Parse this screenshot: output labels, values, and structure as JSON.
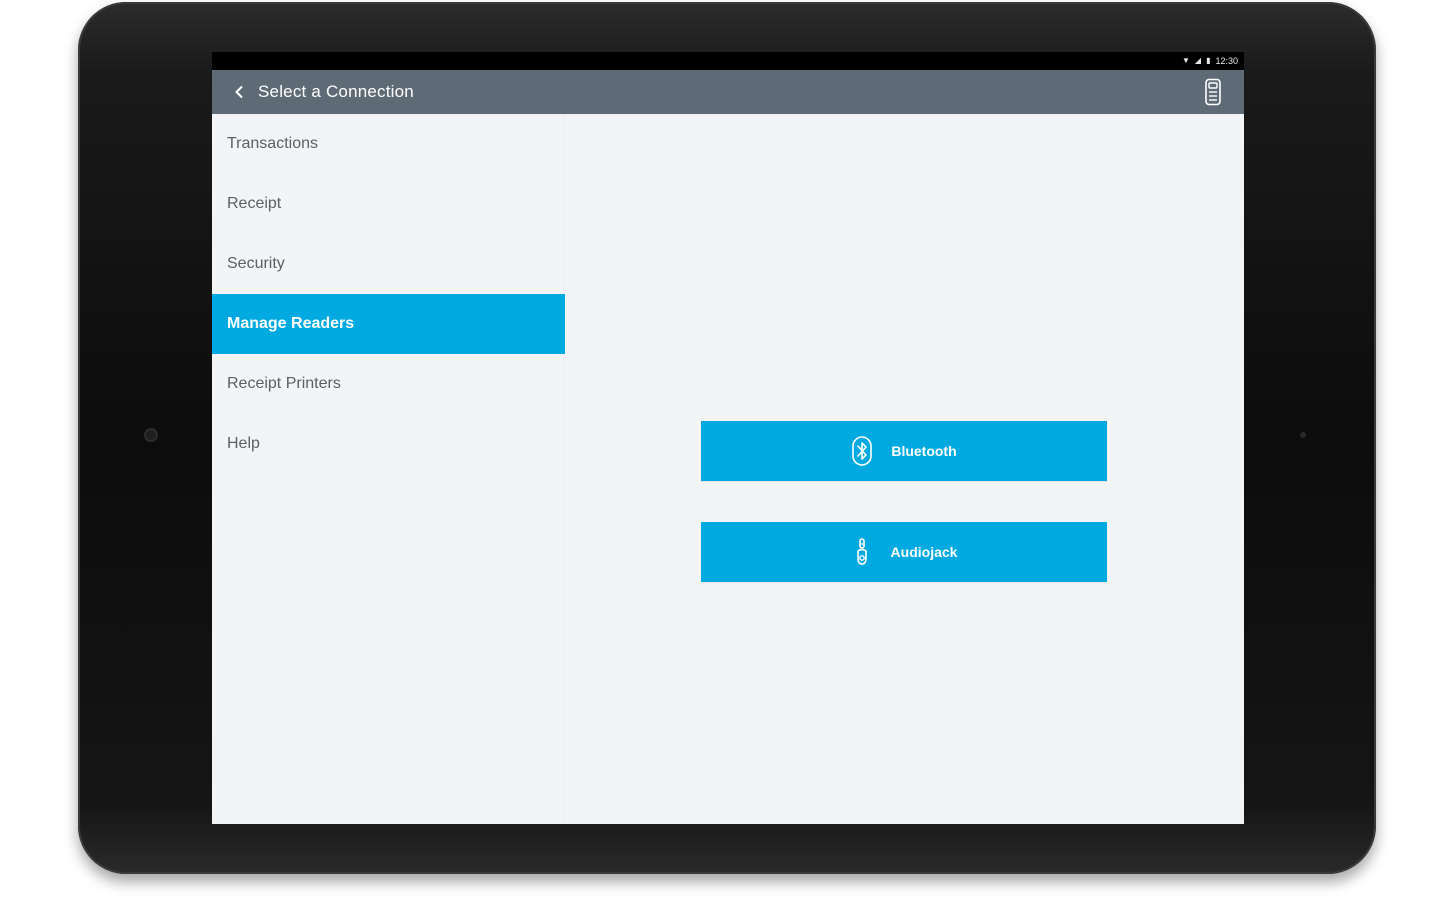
{
  "status_bar": {
    "wifi_icon": "wifi-icon",
    "signal_icon": "signal-icon",
    "battery_icon": "battery-icon",
    "time": "12:30"
  },
  "app_bar": {
    "back_icon": "chevron-left-icon",
    "title": "Select a Connection",
    "reader_icon": "card-reader-icon",
    "background": "#5e6a76"
  },
  "sidebar": {
    "items": [
      {
        "label": "Transactions",
        "active": false
      },
      {
        "label": "Receipt",
        "active": false
      },
      {
        "label": "Security",
        "active": false
      },
      {
        "label": "Manage Readers",
        "active": true
      },
      {
        "label": "Receipt Printers",
        "active": false
      },
      {
        "label": "Help",
        "active": false
      }
    ],
    "active_color": "#00a9e0"
  },
  "content": {
    "bluetooth_button": {
      "label": "Bluetooth",
      "icon": "bluetooth-icon"
    },
    "audiojack_button": {
      "label": "Audiojack",
      "icon": "audiojack-icon"
    },
    "button_color": "#00a9e0"
  }
}
